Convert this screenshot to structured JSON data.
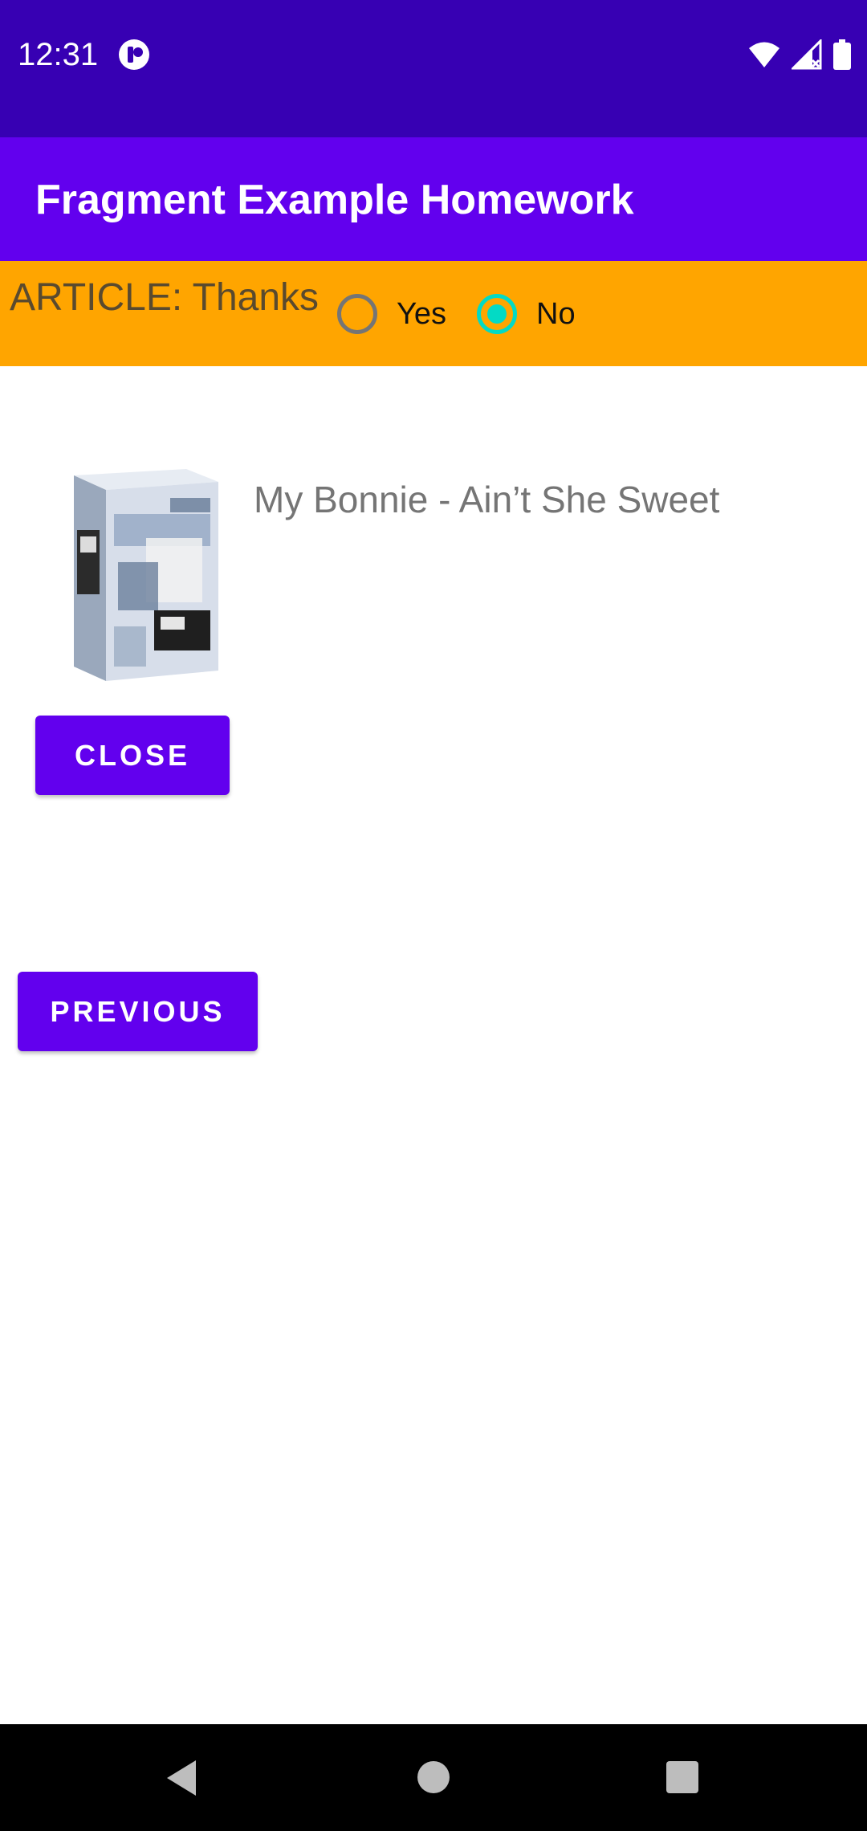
{
  "status_bar": {
    "time": "12:31",
    "icons": [
      "notification-app-icon",
      "wifi-icon",
      "cellular-signal-icon",
      "battery-icon"
    ],
    "background": "#3700B3"
  },
  "app_bar": {
    "title": "Fragment Example Homework",
    "background": "#6200EE"
  },
  "article": {
    "label": "ARTICLE: Thanks",
    "background": "#FFA500",
    "options": [
      {
        "label": "Yes",
        "checked": false
      },
      {
        "label": "No",
        "checked": true
      }
    ],
    "accent": "#03DAC5"
  },
  "song": {
    "title": "My Bonnie - Ain’t She Sweet",
    "image": "album-box-set-image"
  },
  "buttons": {
    "close_label": "Close",
    "previous_label": "Previous",
    "color": "#6200EE"
  },
  "nav_bar": {
    "icons": [
      "back-icon",
      "home-icon",
      "recents-icon"
    ]
  }
}
